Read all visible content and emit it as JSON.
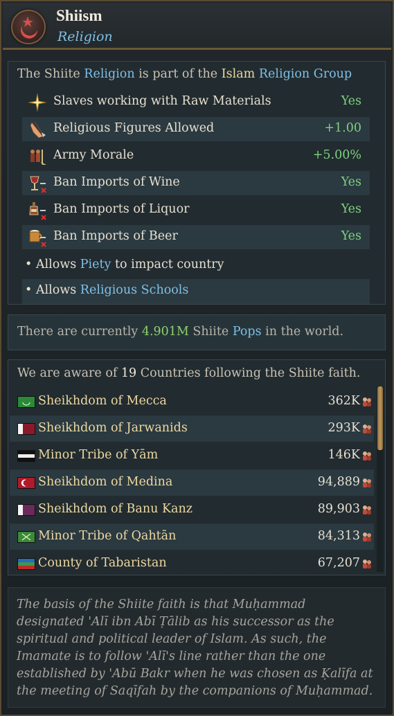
{
  "header": {
    "title": "Shiism",
    "subtitle": "Religion",
    "icon": "star-crescent-icon"
  },
  "modifiers_panel": {
    "intro": {
      "prefix": "The Shiite ",
      "religion_word": "Religion",
      "middle": " is part of the ",
      "group_name": "Islam",
      "space": " ",
      "group_word": "Religion Group"
    },
    "rows": [
      {
        "label": "Slaves working with Raw Materials",
        "value": "Yes",
        "icon": "compass-star-icon"
      },
      {
        "label": "Religious Figures Allowed",
        "value": "+1.00",
        "icon": "praying-hands-icon"
      },
      {
        "label": "Army Morale",
        "value": "+5.00%",
        "icon": "soldiers-icon"
      },
      {
        "label": "Ban Imports of Wine",
        "value": "Yes",
        "icon": "wine-banned-icon"
      },
      {
        "label": "Ban Imports of Liquor",
        "value": "Yes",
        "icon": "liquor-banned-icon"
      },
      {
        "label": "Ban Imports of Beer",
        "value": "Yes",
        "icon": "beer-banned-icon"
      }
    ],
    "bullets": [
      {
        "prefix": "• Allows ",
        "link": "Piety",
        "suffix": " to impact country"
      },
      {
        "prefix": "• Allows ",
        "link": "Religious Schools",
        "suffix": ""
      }
    ]
  },
  "pops_panel": {
    "prefix": "There are currently ",
    "amount": "4.901M",
    "middle": " Shiite ",
    "link": "Pops",
    "suffix": " in the world."
  },
  "countries_panel": {
    "prefix": "We are aware of ",
    "count": "19",
    "suffix": " Countries following the Shiite faith.",
    "countries": [
      {
        "name": "Sheikhdom of Mecca",
        "pops": "362K",
        "flag": "green-crescent-flag"
      },
      {
        "name": "Sheikhdom of Jarwanids",
        "pops": "293K",
        "flag": "maroon-white-flag"
      },
      {
        "name": "Minor Tribe of Yām",
        "pops": "146K",
        "flag": "black-white-striped-flag"
      },
      {
        "name": "Sheikhdom of Medina",
        "pops": "94,889",
        "flag": "red-crescent-flag"
      },
      {
        "name": "Sheikhdom of Banu Kanz",
        "pops": "89,903",
        "flag": "purple-white-flag"
      },
      {
        "name": "Minor Tribe of Qahtān",
        "pops": "84,313",
        "flag": "green-swords-flag"
      },
      {
        "name": "County of Tabaristan",
        "pops": "67,207",
        "flag": "tricolor-flag"
      }
    ]
  },
  "description": "The basis of the Shiite faith is that Muḥammad designated 'Alī ibn Abī Ṭālib as his successor as the spiritual and political leader of Islam. As such, the Imamate is to follow 'Alī's line rather than the one established by 'Abū Bakr when he was chosen as Ḳalīfa at the meeting of Saqīfah by the companions of Muḥammad.",
  "colors": {
    "accent_blue": "#7fc0e6",
    "positive_green": "#7fd17f",
    "gold": "#e9d99b",
    "border_bronze": "#6b5836"
  }
}
